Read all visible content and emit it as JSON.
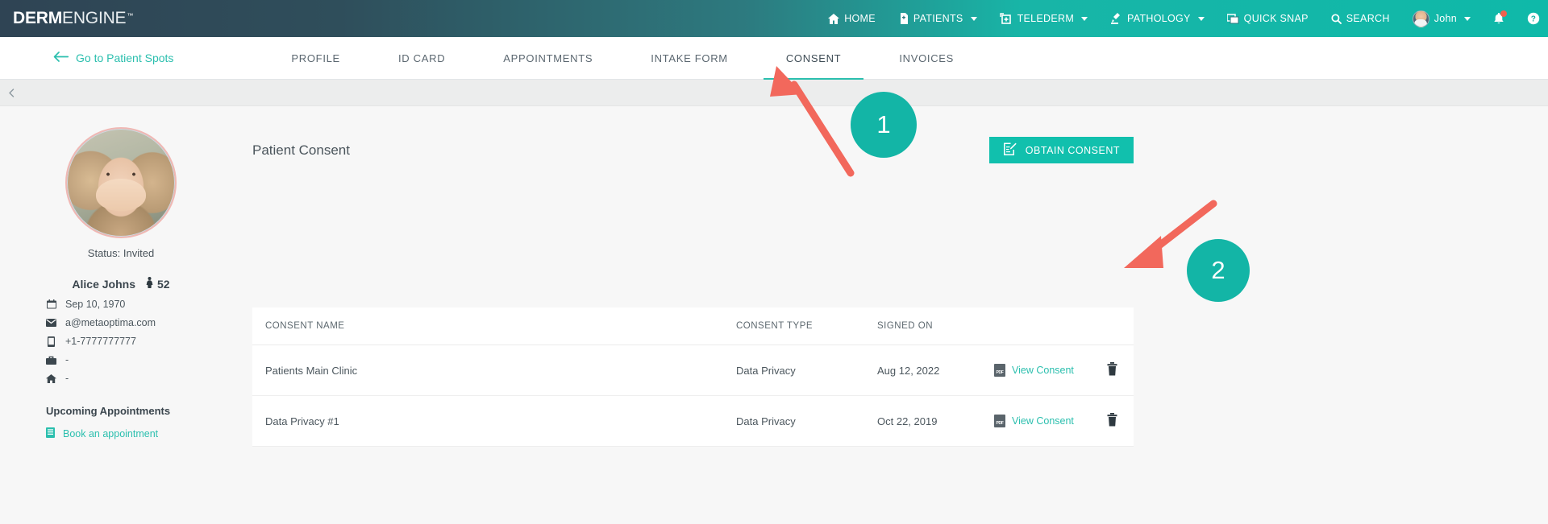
{
  "brand": {
    "name_bold": "DERM",
    "name_light": "ENGINE",
    "trademark": "™",
    "accent_teal": "#11c0ad",
    "header_dark": "#2f4454",
    "annotation_red": "#f2685c"
  },
  "topnav": {
    "items": [
      {
        "label": "HOME",
        "icon": "home-icon",
        "caret": false
      },
      {
        "label": "PATIENTS",
        "icon": "patients-icon",
        "caret": true
      },
      {
        "label": "TELEDERM",
        "icon": "telederm-icon",
        "caret": true
      },
      {
        "label": "PATHOLOGY",
        "icon": "pathology-icon",
        "caret": true
      },
      {
        "label": "QUICK SNAP",
        "icon": "quick-snap-icon",
        "caret": false
      },
      {
        "label": "SEARCH",
        "icon": "search-icon",
        "caret": false
      }
    ],
    "user": {
      "label": "John",
      "icon": "user-avatar",
      "caret": true
    },
    "notifications_icon": "bell-icon",
    "help_icon": "help-icon"
  },
  "subnav": {
    "back_label": "Go to Patient Spots",
    "back_icon": "arrow-left-icon",
    "tabs": [
      {
        "label": "PROFILE",
        "active": false
      },
      {
        "label": "ID CARD",
        "active": false
      },
      {
        "label": "APPOINTMENTS",
        "active": false
      },
      {
        "label": "INTAKE FORM",
        "active": false
      },
      {
        "label": "CONSENT",
        "active": true
      },
      {
        "label": "INVOICES",
        "active": false
      }
    ],
    "collapse_icon": "chevron-left-icon"
  },
  "patient": {
    "avatar_icon": "patient-photo",
    "status": "Status: Invited",
    "name": "Alice Johns",
    "age": "52",
    "gender_icon": "female-icon",
    "details": [
      {
        "icon": "calendar-icon",
        "value": "Sep 10, 1970"
      },
      {
        "icon": "mail-icon",
        "value": "a@metaoptima.com"
      },
      {
        "icon": "phone-icon",
        "value": "+1-7777777777"
      },
      {
        "icon": "briefcase-icon",
        "value": "-"
      },
      {
        "icon": "home-icon",
        "value": "-"
      }
    ],
    "upcoming_title": "Upcoming Appointments",
    "book_link": "Book an appointment",
    "book_icon": "calendar-book-icon"
  },
  "consent": {
    "title": "Patient Consent",
    "obtain_button": "OBTAIN CONSENT",
    "obtain_icon": "document-edit-icon",
    "columns": [
      "CONSENT NAME",
      "CONSENT TYPE",
      "SIGNED ON",
      "",
      ""
    ],
    "view_label": "View Consent",
    "view_icon": "pdf-icon",
    "delete_icon": "trash-icon",
    "rows": [
      {
        "name": "Patients Main Clinic",
        "type": "Data Privacy",
        "signed_on": "Aug 12, 2022"
      },
      {
        "name": "Data Privacy #1",
        "type": "Data Privacy",
        "signed_on": "Oct 22, 2019"
      }
    ]
  },
  "annotations": [
    {
      "number": "1",
      "target": "consent-tab"
    },
    {
      "number": "2",
      "target": "delete-consent-row-1"
    }
  ]
}
